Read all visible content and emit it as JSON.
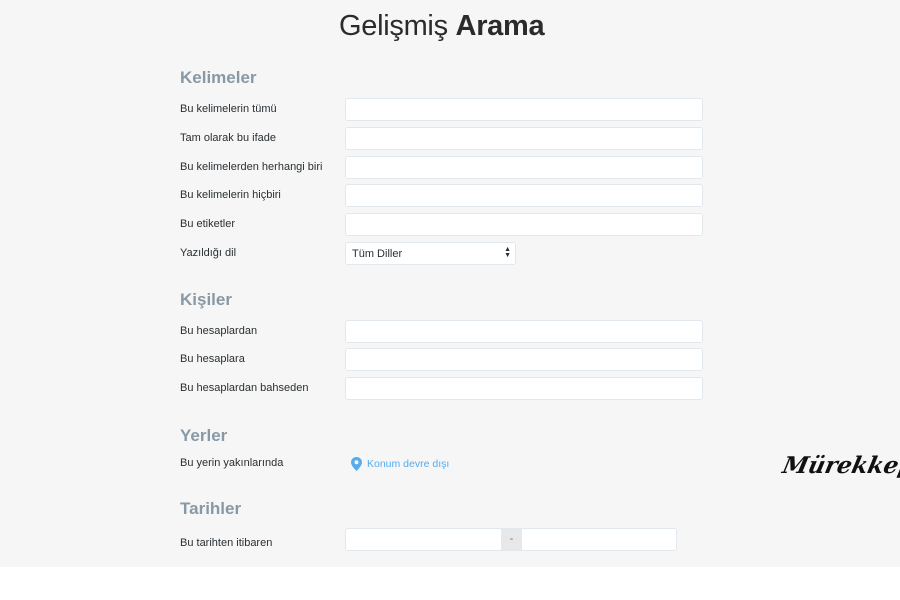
{
  "title": {
    "light": "Gelişmiş",
    "bold": "Arama"
  },
  "sections": {
    "words": {
      "heading": "Kelimeler",
      "all_words_label": "Bu kelimelerin tümü",
      "exact_phrase_label": "Tam olarak bu ifade",
      "any_words_label": "Bu kelimelerden herhangi biri",
      "none_words_label": "Bu kelimelerin hiçbiri",
      "hashtags_label": "Bu etiketler",
      "language_label": "Yazıldığı dil",
      "language_value": "Tüm Diller"
    },
    "people": {
      "heading": "Kişiler",
      "from_label": "Bu hesaplardan",
      "to_label": "Bu hesaplara",
      "mentioning_label": "Bu hesaplardan bahseden"
    },
    "places": {
      "heading": "Yerler",
      "near_label": "Bu yerin yakınlarında",
      "location_link": "Konum devre dışı",
      "location_icon": "map-pin-icon"
    },
    "dates": {
      "heading": "Tarihler",
      "since_label": "Bu tarihten itibaren",
      "separator": "-"
    }
  },
  "watermark": "Mürekkep",
  "colors": {
    "background": "#f6f6f6",
    "heading": "#8899a6",
    "link": "#55acee",
    "input_border": "#e1e8ed"
  }
}
